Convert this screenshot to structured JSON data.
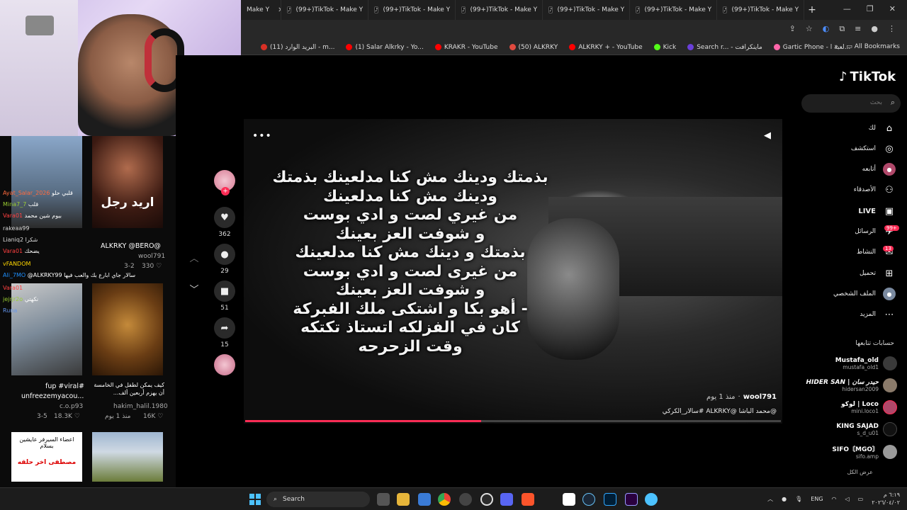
{
  "browser": {
    "tabs": [
      {
        "label": "Make Y"
      },
      {
        "label": "(99+)TikTok - Make Y"
      },
      {
        "label": "(99+)TikTok - Make Y"
      },
      {
        "label": "(99+)TikTok - Make Y"
      },
      {
        "label": "(99+)TikTok - Make Y"
      },
      {
        "label": "(99+)TikTok - Make Y"
      },
      {
        "label": "(99+)TikTok - Make Y"
      }
    ],
    "new_tab": "+",
    "bookmarks": [
      {
        "label": "(11) البريد الوارد - m...",
        "color": "#d93025"
      },
      {
        "label": "(1) Salar Alkrky - Yo...",
        "color": "#ff0000"
      },
      {
        "label": "KRAKR - YouTube",
        "color": "#ff0000"
      },
      {
        "label": "(50) ALKRKY",
        "color": "#e04a3f"
      },
      {
        "label": "ALKRKY + - YouTube",
        "color": "#ff0000"
      },
      {
        "label": "Kick",
        "color": "#53fc18"
      },
      {
        "label": "Search r... - ماينكرافت",
        "color": "#6a3fd9"
      },
      {
        "label": "Gartic Phone - لعبة ا...",
        "color": "#f6a"
      }
    ],
    "all_bookmarks": "All Bookmarks"
  },
  "stream_left": {
    "thumbs": [
      {
        "title": "اريد رجل",
        "author": "ALKRKY @BERO@",
        "user": "wool791",
        "date": "3-2",
        "likes": "330"
      },
      {
        "title": "fup #viral#",
        "author": "unfreezemyacou...",
        "user": "c.o.p93",
        "date": "3-5",
        "likes": "18.3K"
      },
      {
        "title": "كيف يمكن لطفل في الخامسة أن يهزم أربعين ألف...",
        "author": "",
        "user": "hakim_halil.1980",
        "date": "منذ 1 يوم",
        "likes": "16K"
      },
      {
        "title": "مصطفى اخر حلقه",
        "author": "اعضاء السيرفر عايشين بسلام",
        "user": "",
        "date": "",
        "likes": ""
      }
    ],
    "chat": [
      {
        "user": "Ayat_Salar_2026",
        "text": "قلبي حلو",
        "color": "#ff6a3d"
      },
      {
        "user": "Mina7_7",
        "text": "قلب",
        "color": "#9acd32"
      },
      {
        "user": "Vara01",
        "text": "بيوم شين محمد",
        "color": "#ff4040"
      },
      {
        "user": "rakeaa99",
        "text": "",
        "color": "#dcdcdc"
      },
      {
        "user": "Lianiq2",
        "text": "شكرا",
        "color": "#dcdcdc"
      },
      {
        "user": "Vara01",
        "text": "يضحك",
        "color": "#ff4040"
      },
      {
        "user": "vFANDOM",
        "text": "",
        "color": "#ffd700"
      },
      {
        "user": "Ali_7MO",
        "text": "@ALKRKY99 سالار جاي ابارع بك والعب فيها",
        "color": "#1e90ff"
      },
      {
        "user": "Vara01",
        "text": "",
        "color": "#ff4040"
      },
      {
        "user": "jejrjr2o",
        "text": "نكهتي",
        "color": "#9acd32"
      },
      {
        "user": "Runa",
        "text": "",
        "color": "#6495ed"
      }
    ]
  },
  "video": {
    "lyrics": [
      "بذمتك ودينك مش كنا مدلعينك بذمتك",
      "ودينك مش كنا مدلعينك",
      "من غيري لصت و ادي بوست",
      "و شوفت العز بعينك",
      "بذمتك و دينك مش كنا مدلعينك",
      "من غيرى لصت و ادي بوست",
      "و شوفت العز بعينك",
      "- أهو بكا و اشتكى ملك الفبركة",
      "كان في الفزلكه اتستاذ تكتكه",
      "وقت الزحرحه"
    ],
    "author": "wool791",
    "posted": "منذ 1 يوم",
    "caption": "@محمد الباشا @ALKRKY #سالار_الكركي",
    "progress": 0.44
  },
  "actions": {
    "likes": "362",
    "comments": "29",
    "saves": "51",
    "shares": "15"
  },
  "tiktok": {
    "logo": "TikTok",
    "search_placeholder": "بحث",
    "nav": [
      {
        "label": "لك",
        "icon": "home-icon",
        "glyph": "⌂"
      },
      {
        "label": "استكشف",
        "icon": "compass-icon",
        "glyph": "◎"
      },
      {
        "label": "أتابعه",
        "icon": "following-avatar-icon",
        "glyph": "●"
      },
      {
        "label": "الأصدقاء",
        "icon": "friends-icon",
        "glyph": "⚇"
      },
      {
        "label": "LIVE",
        "icon": "live-icon",
        "glyph": "▣"
      },
      {
        "label": "الرسائل",
        "icon": "messages-icon",
        "glyph": "✈",
        "badge": "99+"
      },
      {
        "label": "النشاط",
        "icon": "activity-icon",
        "glyph": "✉",
        "badge": "13"
      },
      {
        "label": "تحميل",
        "icon": "upload-icon",
        "glyph": "⊞"
      },
      {
        "label": "الملف الشخصي",
        "icon": "profile-avatar-icon",
        "glyph": "●"
      },
      {
        "label": "المزيد",
        "icon": "more-icon",
        "glyph": "⋯"
      }
    ],
    "following_title": "حسابات تتابعها",
    "following": [
      {
        "name": "Mustafa_old",
        "user": "mustafa_old1"
      },
      {
        "name": "HIDER SAN | حيدر سان",
        "user": "hidersan2009"
      },
      {
        "name": "لوكو | Loco",
        "user": "mini.loco1"
      },
      {
        "name": "KING SAJAD",
        "user": "s_d_u01"
      },
      {
        "name": "SIFO〘MGO〙",
        "user": "sifo.amp"
      }
    ],
    "see_all": "عرض الكل"
  },
  "taskbar": {
    "search": "Search",
    "lang": "ENG",
    "time": "٦:١٩ م",
    "date": "٢٠٢٦/٠٤/٠٢"
  }
}
